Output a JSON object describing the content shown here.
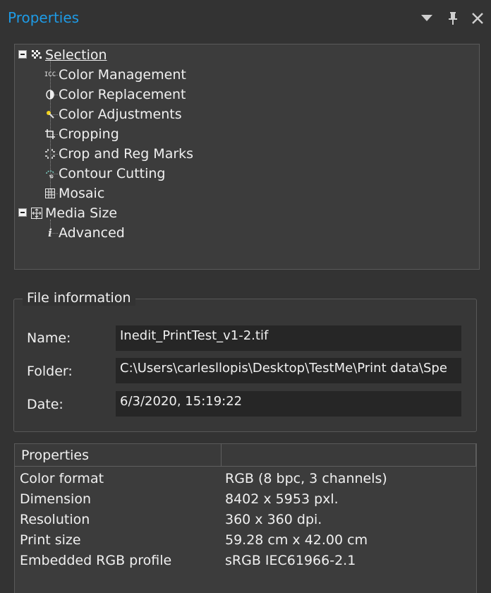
{
  "panel": {
    "title": "Properties",
    "controls": {
      "dropdown_icon": "triangle-down-icon",
      "pin_icon": "pin-icon",
      "close_icon": "close-icon"
    }
  },
  "tree": {
    "root": {
      "label": "Selection",
      "icon": "selection-icon"
    },
    "children": [
      {
        "label": "Color Management",
        "icon": "icc-icon"
      },
      {
        "label": "Color Replacement",
        "icon": "contrast-icon"
      },
      {
        "label": "Color Adjustments",
        "icon": "adjust-wand-icon"
      },
      {
        "label": "Cropping",
        "icon": "crop-icon"
      },
      {
        "label": "Crop and Reg Marks",
        "icon": "crop-marks-icon"
      },
      {
        "label": "Contour Cutting",
        "icon": "contour-cut-icon"
      },
      {
        "label": "Mosaic",
        "icon": "mosaic-grid-icon"
      }
    ],
    "root2": {
      "label": "Media Size",
      "icon": "media-size-icon"
    },
    "children2": [
      {
        "label": "Advanced",
        "icon": "info-icon"
      }
    ]
  },
  "file_info": {
    "legend": "File information",
    "name_label": "Name:",
    "name_value": "Inedit_PrintTest_v1-2.tif",
    "folder_label": "Folder:",
    "folder_value": "C:\\Users\\carlesllopis\\Desktop\\TestMe\\Print data\\Spe",
    "date_label": "Date:",
    "date_value": "6/3/2020, 15:19:22"
  },
  "properties": {
    "headers": [
      "Properties",
      ""
    ],
    "rows": [
      [
        "Color format",
        "RGB (8 bpc, 3 channels)"
      ],
      [
        "Dimension",
        "8402 x 5953 pxl."
      ],
      [
        "Resolution",
        "360 x 360 dpi."
      ],
      [
        "Print size",
        "59.28 cm x 42.00 cm"
      ],
      [
        "Embedded RGB profile",
        "sRGB IEC61966-2.1"
      ]
    ]
  }
}
